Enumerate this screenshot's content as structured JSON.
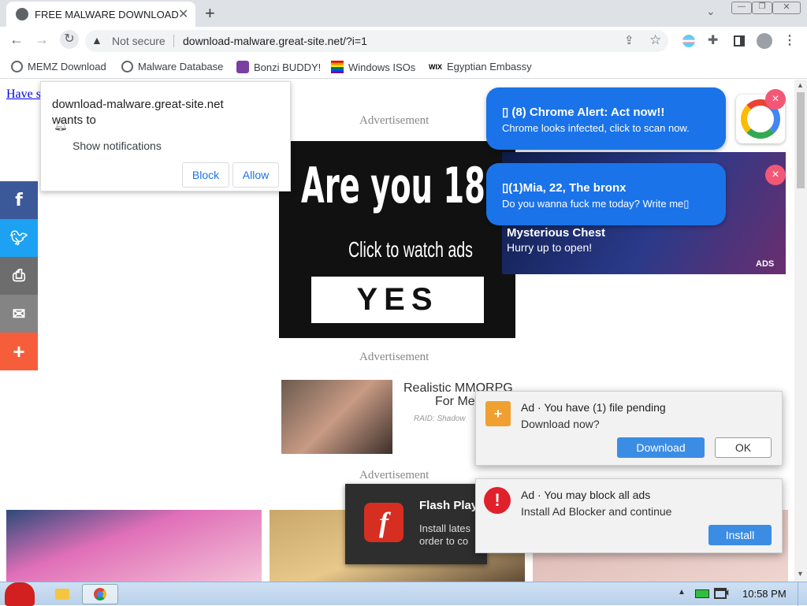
{
  "browser": {
    "tab_title": "FREE MALWARE DOWNLOAD",
    "new_tab_symbol": "+",
    "security_label": "Not secure",
    "url": "download-malware.great-site.net/?i=1",
    "icons": [
      "back-icon",
      "forward-icon",
      "reload-icon",
      "warning-icon",
      "share-icon",
      "star-icon",
      "extensions-icon",
      "sidepanel-icon",
      "profile-icon",
      "menu-icon"
    ],
    "bookmarks": [
      {
        "label": "MEMZ Download",
        "icon": "globe-icon"
      },
      {
        "label": "Malware Database",
        "icon": "globe-icon"
      },
      {
        "label": "Bonzi BUDDY!",
        "icon": "bonzi-icon"
      },
      {
        "label": "Windows ISOs",
        "icon": "windows-flag-icon"
      },
      {
        "label": "Egyptian Embassy",
        "icon": "wix-icon"
      }
    ],
    "wix_text": "WIX"
  },
  "permission_prompt": {
    "site": "download-malware.great-site.net",
    "wants_to": "wants to",
    "request": "Show notifications",
    "block_label": "Block",
    "allow_label": "Allow"
  },
  "page": {
    "link_text": "Have s",
    "ad_label": "Advertisement",
    "banner": {
      "headline": "Are you 18+?",
      "subtitle": "Click to watch ads",
      "button": "YES"
    },
    "mmorpg": {
      "title": "Realistic MMORPG",
      "subtitle": "For Me",
      "source": "RAID: Shadow"
    },
    "chest": {
      "title": "Mysterious Chest",
      "subtitle": "Hurry up to open!",
      "ads_tag": "ADS"
    },
    "flash": {
      "title": "Flash Play",
      "line1": "Install lates",
      "line2": "order to co"
    },
    "social": [
      "f",
      "t",
      "print",
      "mail",
      "+"
    ]
  },
  "bubbles": [
    {
      "title": "▯ (8) Chrome Alert: Act now!!",
      "body": "Chrome looks infected, click to scan now.",
      "close": "×"
    },
    {
      "title": "▯(1)Mia, 22, The bronx",
      "body": "Do you wanna fuck me today? Write me▯",
      "close": "×"
    }
  ],
  "notifications": [
    {
      "title": "Ad · You have (1) file pending",
      "body": "Download now?",
      "primary": "Download",
      "secondary": "OK"
    },
    {
      "title": "Ad · You may block all ads",
      "body": "Install Ad Blocker and continue",
      "primary": "Install"
    }
  ],
  "taskbar": {
    "time": "10:58 PM"
  },
  "colors": {
    "accent": "#1a73e8",
    "notif_button": "#3b8de4",
    "close_pink": "#f25876",
    "facebook": "#3b5998",
    "twitter": "#1da1f2",
    "print": "#6d6d6d",
    "email": "#848484",
    "share": "#f65e3b"
  }
}
